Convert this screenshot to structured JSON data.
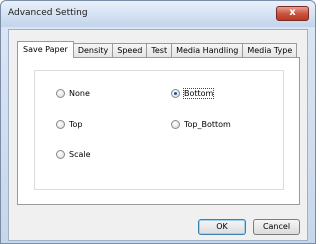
{
  "window": {
    "title": "Advanced Setting",
    "close_glyph": "x"
  },
  "tabs": [
    {
      "label": "Save Paper",
      "active": true
    },
    {
      "label": "Density"
    },
    {
      "label": "Speed"
    },
    {
      "label": "Test"
    },
    {
      "label": "Media Handling"
    },
    {
      "label": "Media Type"
    }
  ],
  "options": {
    "none": {
      "label": "None",
      "checked": false
    },
    "top": {
      "label": "Top",
      "checked": false
    },
    "scale": {
      "label": "Scale",
      "checked": false
    },
    "bottom": {
      "label": "Bottom",
      "checked": true
    },
    "top_bottom": {
      "label": "Top_Bottom",
      "checked": false
    }
  },
  "buttons": {
    "ok": "OK",
    "cancel": "Cancel"
  }
}
